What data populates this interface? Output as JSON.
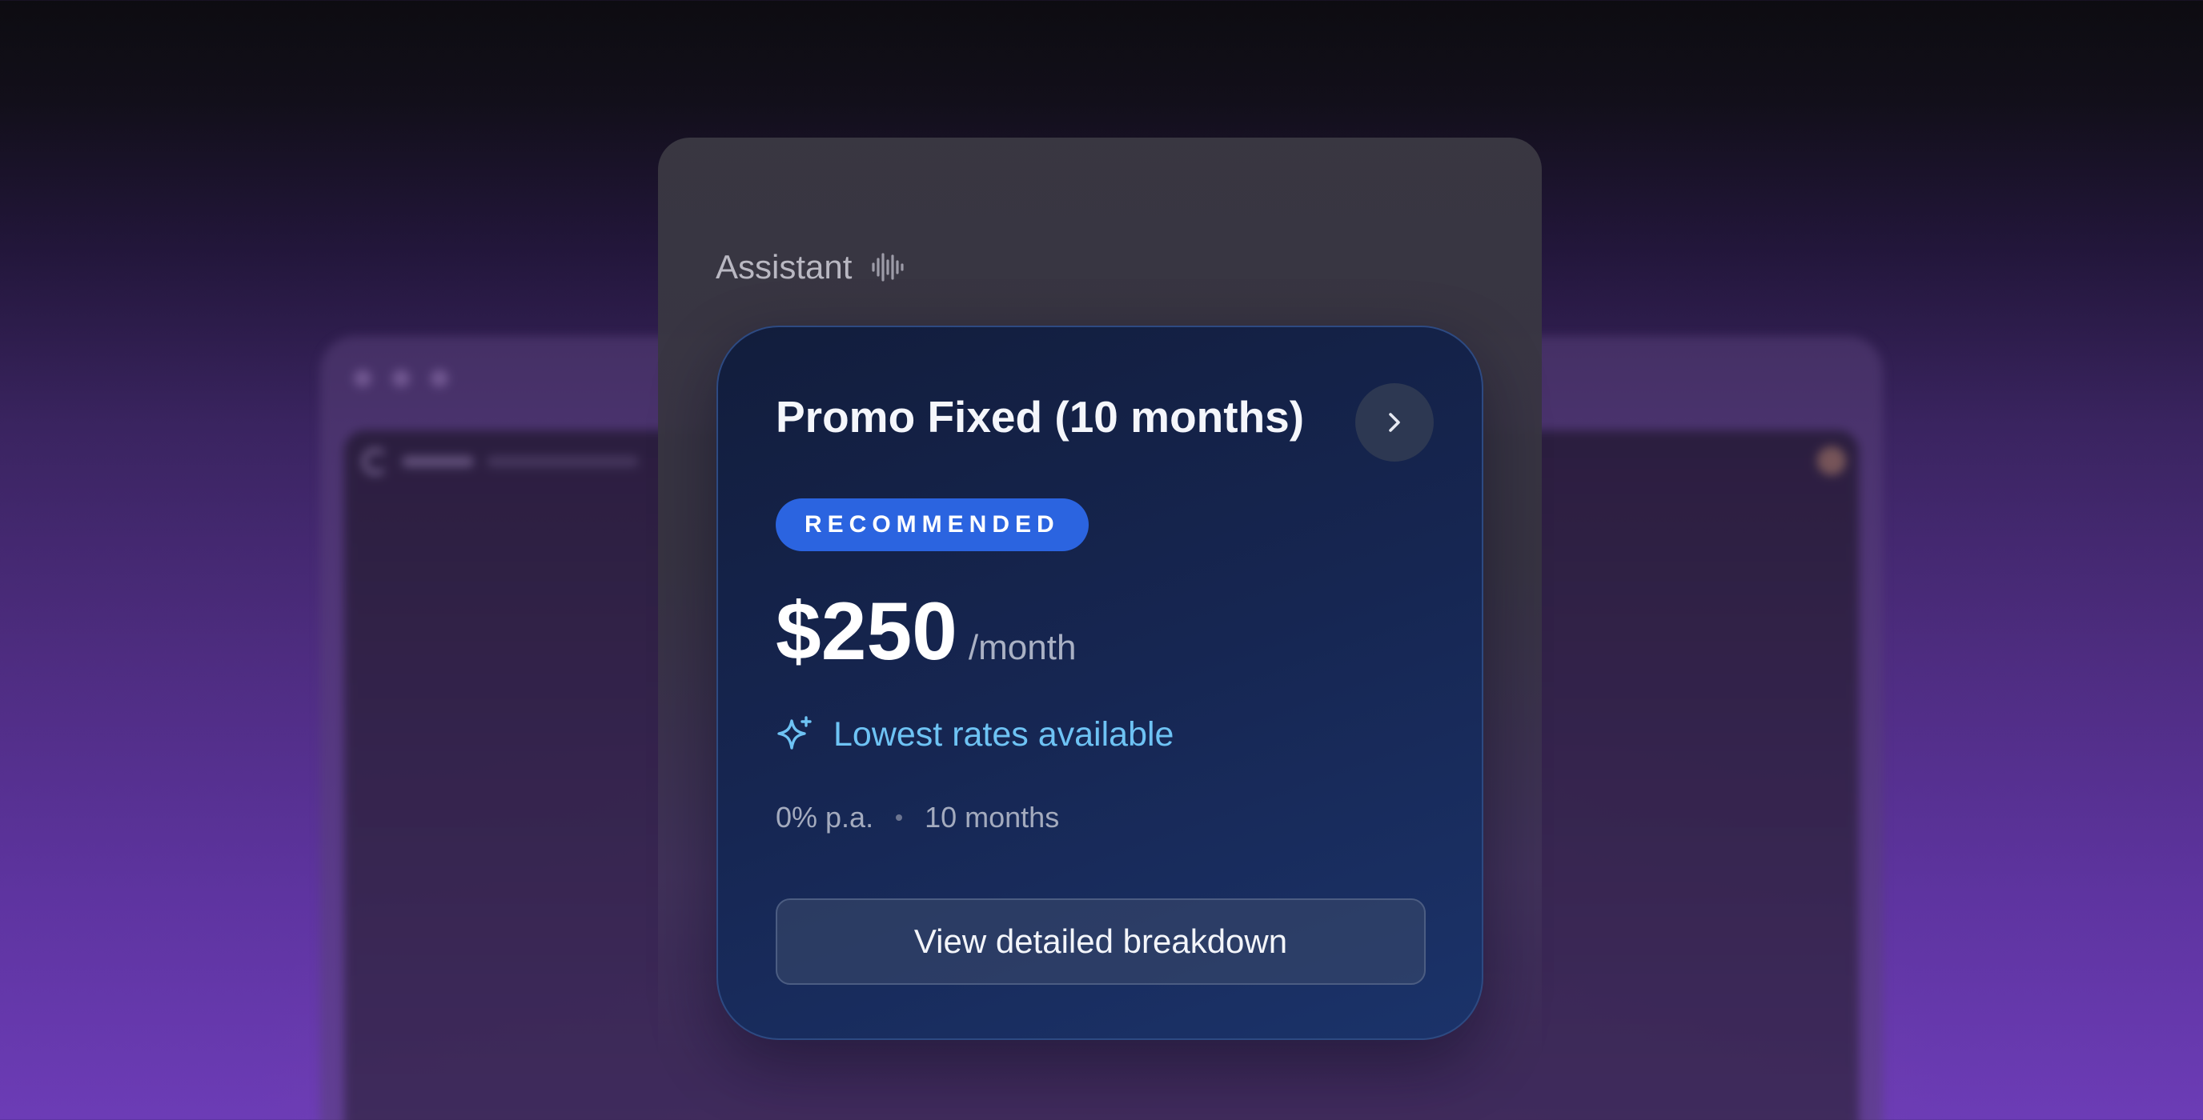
{
  "assistant": {
    "label": "Assistant",
    "icon": "audio-wave-icon"
  },
  "plan_card": {
    "title": "Promo Fixed (10 months)",
    "details_icon": "chevron-right-icon",
    "badge": "RECOMMENDED",
    "price": "$250",
    "price_period": "/month",
    "feature_icon": "sparkles-icon",
    "feature_text": "Lowest rates available",
    "rate": "0% p.a.",
    "term": "10 months",
    "cta_label": "View detailed breakdown"
  },
  "colors": {
    "card_background": "#162652",
    "badge_background": "#2b64e0",
    "feature_accent": "#6ec3f4",
    "background_purple": "#5e34a0"
  }
}
